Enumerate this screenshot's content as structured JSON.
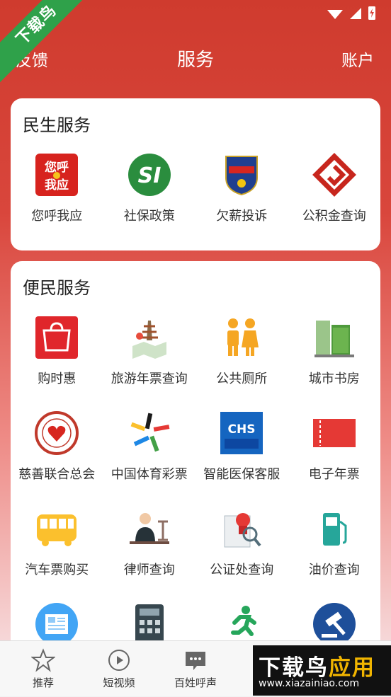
{
  "header": {
    "left": "反馈",
    "title": "服务",
    "right": "账户"
  },
  "ribbon": "下载鸟",
  "sections": [
    {
      "title": "民生服务",
      "items": [
        {
          "label": "您呼我应",
          "icon": "red-call-badge-icon"
        },
        {
          "label": "社保政策",
          "icon": "si-logo-icon"
        },
        {
          "label": "欠薪投诉",
          "icon": "labor-supervision-badge-icon"
        },
        {
          "label": "公积金查询",
          "icon": "housing-fund-logo-icon"
        }
      ]
    },
    {
      "title": "便民服务",
      "items": [
        {
          "label": "购时惠",
          "icon": "shopping-bag-icon"
        },
        {
          "label": "旅游年票查询",
          "icon": "pagoda-map-icon"
        },
        {
          "label": "公共厕所",
          "icon": "restroom-icon"
        },
        {
          "label": "城市书房",
          "icon": "book-building-icon"
        },
        {
          "label": "慈善联合总会",
          "icon": "charity-heart-seal-icon"
        },
        {
          "label": "中国体育彩票",
          "icon": "sports-lottery-icon"
        },
        {
          "label": "智能医保客服",
          "icon": "medical-insurance-icon"
        },
        {
          "label": "电子年票",
          "icon": "ticket-icon"
        },
        {
          "label": "汽车票购买",
          "icon": "bus-icon"
        },
        {
          "label": "律师查询",
          "icon": "lawyer-icon"
        },
        {
          "label": "公证处查询",
          "icon": "notary-stamp-icon"
        },
        {
          "label": "油价查询",
          "icon": "fuel-pump-icon"
        },
        {
          "label": "",
          "icon": "newspaper-icon"
        },
        {
          "label": "",
          "icon": "calculator-icon"
        },
        {
          "label": "",
          "icon": "running-man-icon"
        },
        {
          "label": "",
          "icon": "gavel-icon"
        }
      ]
    }
  ],
  "tabs": [
    {
      "label": "推荐",
      "icon": "star-icon"
    },
    {
      "label": "短视频",
      "icon": "play-circle-icon"
    },
    {
      "label": "百姓呼声",
      "icon": "chat-bubble-icon"
    }
  ],
  "watermark": {
    "brand_a": "下载鸟",
    "brand_b": "应用",
    "url": "www.xiazainiao.com"
  }
}
